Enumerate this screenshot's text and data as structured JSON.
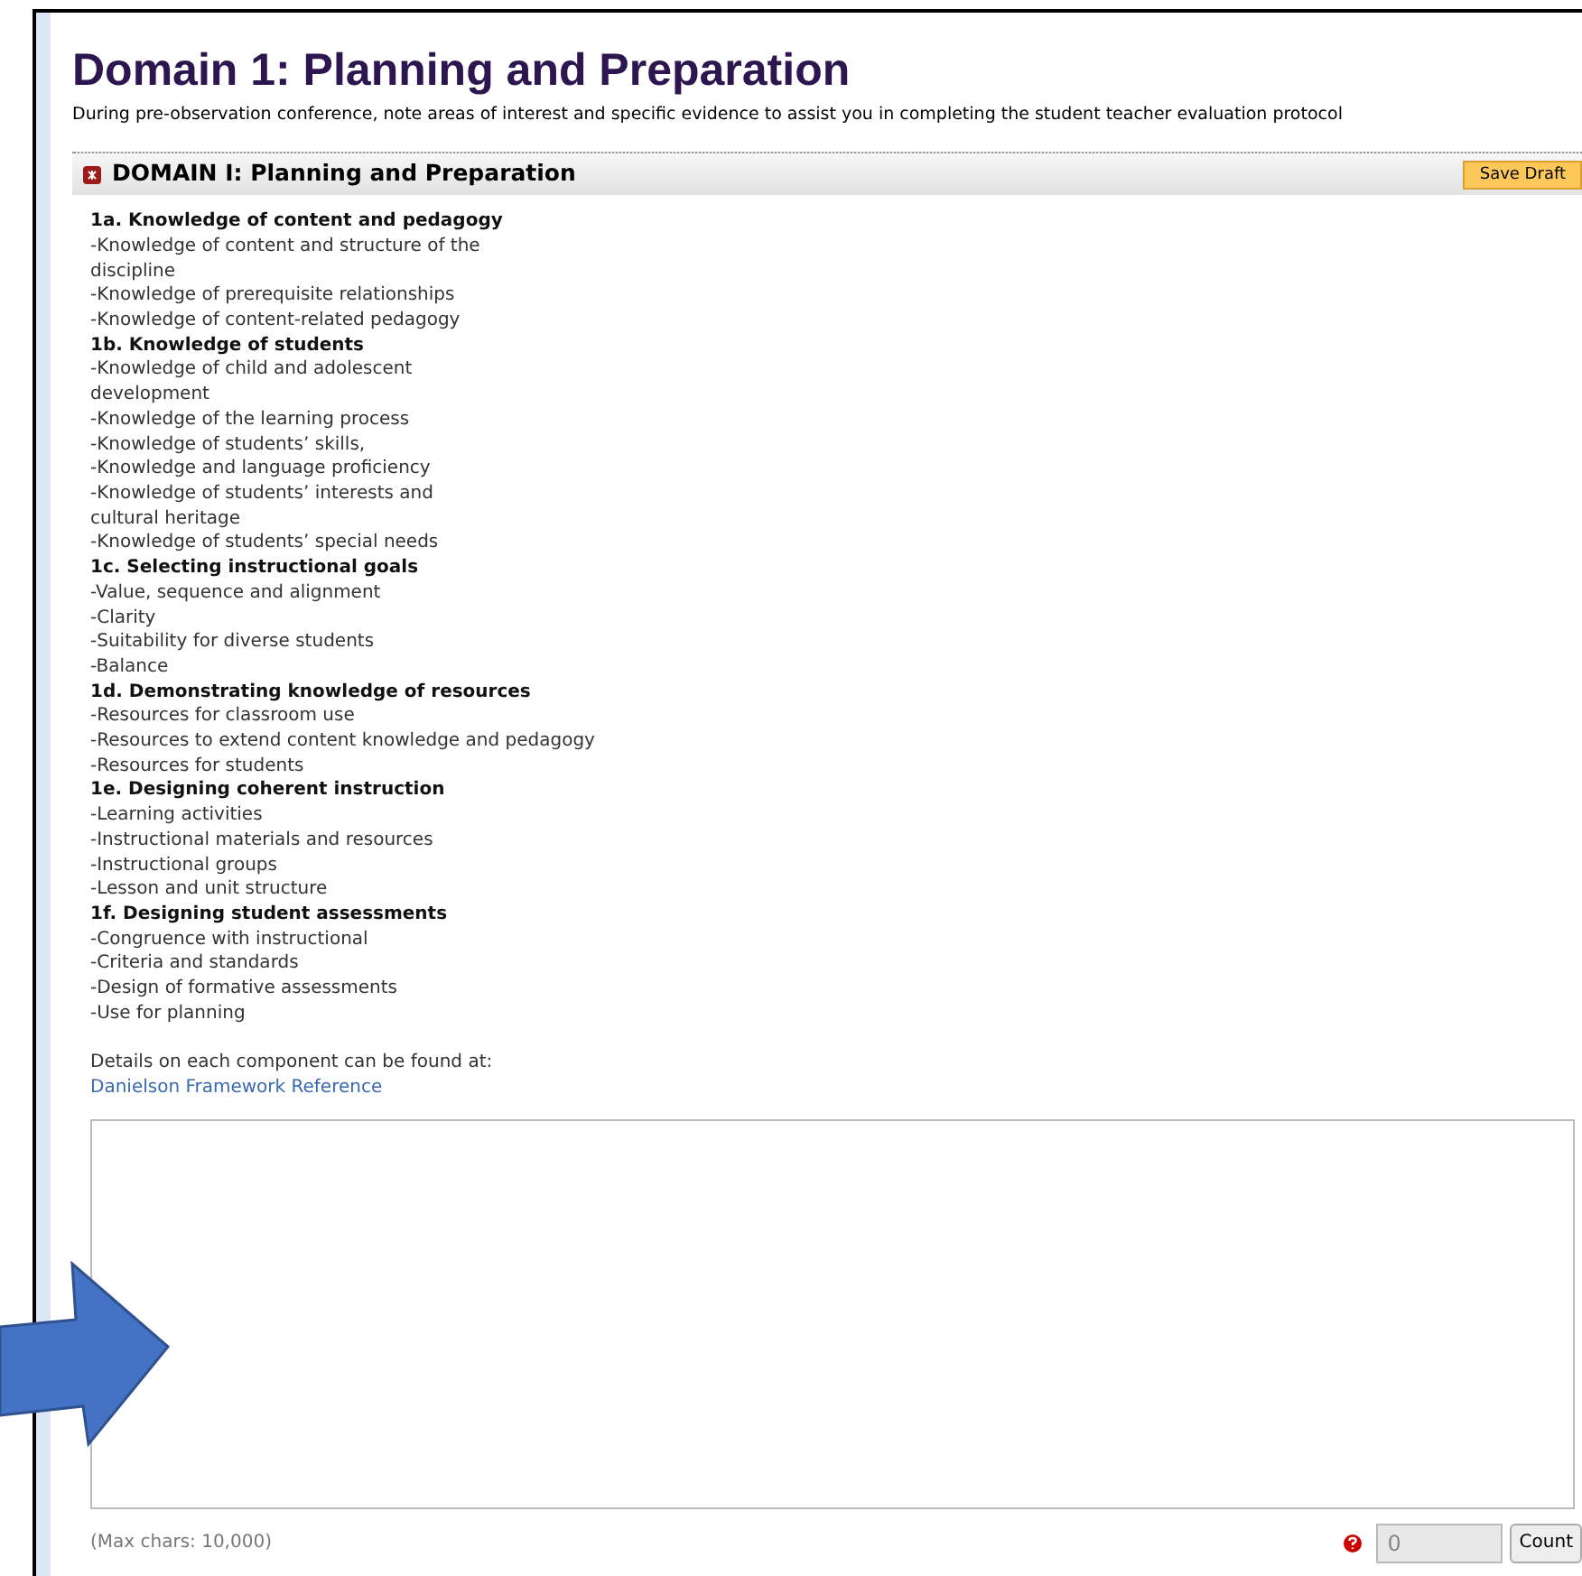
{
  "page": {
    "title": "Domain 1: Planning and Preparation",
    "intro": "During pre-observation conference, note areas of interest and specific evidence to assist you in completing the student teacher evaluation protocol"
  },
  "section": {
    "title": "DOMAIN I: Planning and Preparation",
    "save_button": "Save Draft"
  },
  "lines": [
    {
      "kind": "heading",
      "text": "1a. Knowledge of content and pedagogy"
    },
    {
      "kind": "item",
      "text": "-Knowledge of content and structure of the"
    },
    {
      "kind": "item",
      "text": "discipline"
    },
    {
      "kind": "item",
      "text": "-Knowledge of prerequisite relationships"
    },
    {
      "kind": "item",
      "text": "-Knowledge of content-related pedagogy"
    },
    {
      "kind": "heading",
      "text": "1b. Knowledge of students"
    },
    {
      "kind": "item",
      "text": "-Knowledge of child and adolescent"
    },
    {
      "kind": "item",
      "text": "development"
    },
    {
      "kind": "item",
      "text": "-Knowledge of the learning process"
    },
    {
      "kind": "item",
      "text": "-Knowledge of students’ skills,"
    },
    {
      "kind": "item",
      "text": "-Knowledge and language proficiency"
    },
    {
      "kind": "item",
      "text": "-Knowledge of students’ interests and"
    },
    {
      "kind": "item",
      "text": "cultural heritage"
    },
    {
      "kind": "item",
      "text": "-Knowledge of students’ special needs"
    },
    {
      "kind": "heading",
      "text": "1c. Selecting instructional goals"
    },
    {
      "kind": "item",
      "text": "-Value, sequence and alignment"
    },
    {
      "kind": "item",
      "text": "-Clarity"
    },
    {
      "kind": "item",
      "text": "-Suitability for diverse students"
    },
    {
      "kind": "item",
      "text": "-Balance"
    },
    {
      "kind": "heading",
      "text": "1d. Demonstrating knowledge of resources"
    },
    {
      "kind": "item",
      "text": "-Resources for classroom use"
    },
    {
      "kind": "item",
      "text": "-Resources to extend content knowledge and pedagogy"
    },
    {
      "kind": "item",
      "text": "-Resources for students"
    },
    {
      "kind": "heading",
      "text": "1e. Designing coherent instruction"
    },
    {
      "kind": "item",
      "text": "-Learning activities"
    },
    {
      "kind": "item",
      "text": "-Instructional materials and resources"
    },
    {
      "kind": "item",
      "text": "-Instructional groups"
    },
    {
      "kind": "item",
      "text": "-Lesson and unit structure"
    },
    {
      "kind": "heading",
      "text": "1f. Designing student assessments"
    },
    {
      "kind": "item",
      "text": "-Congruence with instructional"
    },
    {
      "kind": "item",
      "text": "-Criteria and standards"
    },
    {
      "kind": "item",
      "text": "-Design of formative assessments"
    },
    {
      "kind": "item",
      "text": "-Use for planning"
    }
  ],
  "details": {
    "text": "Details on each component can be found at:",
    "link": "Danielson Framework Reference"
  },
  "footer": {
    "max_chars": "(Max chars: 10,000)",
    "count_value": "0",
    "count_button": "Count"
  }
}
